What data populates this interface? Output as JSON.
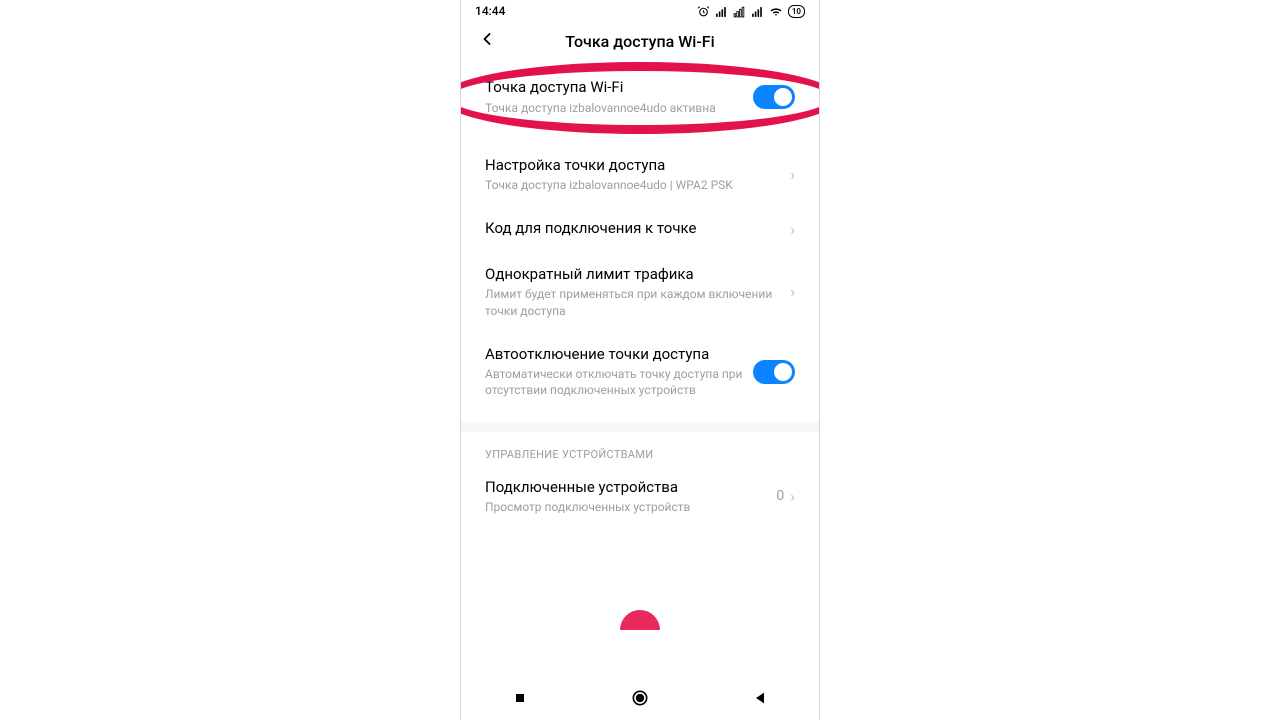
{
  "statusbar": {
    "time": "14:44",
    "battery": "10"
  },
  "header": {
    "title": "Точка доступа Wi-Fi"
  },
  "rows": {
    "hotspot_toggle": {
      "title": "Точка доступа Wi-Fi",
      "sub": "Точка доступа izbalovannoe4udo активна"
    },
    "setup": {
      "title": "Настройка точки доступа",
      "sub": "Точка доступа izbalovannoe4udo | WPA2 PSK"
    },
    "qr": {
      "title": "Код для подключения к точке"
    },
    "limit": {
      "title": "Однократный лимит трафика",
      "sub": "Лимит будет применяться при каждом включении точки доступа"
    },
    "autooff": {
      "title": "Автоотключение точки доступа",
      "sub": "Автоматически отключать точку доступа при отсутствии подключенных устройств"
    },
    "connected": {
      "title": "Подключенные устройства",
      "sub": "Просмотр подключенных устройств",
      "value": "0"
    }
  },
  "sections": {
    "devices": "УПРАВЛЕНИЕ УСТРОЙСТВАМИ"
  }
}
